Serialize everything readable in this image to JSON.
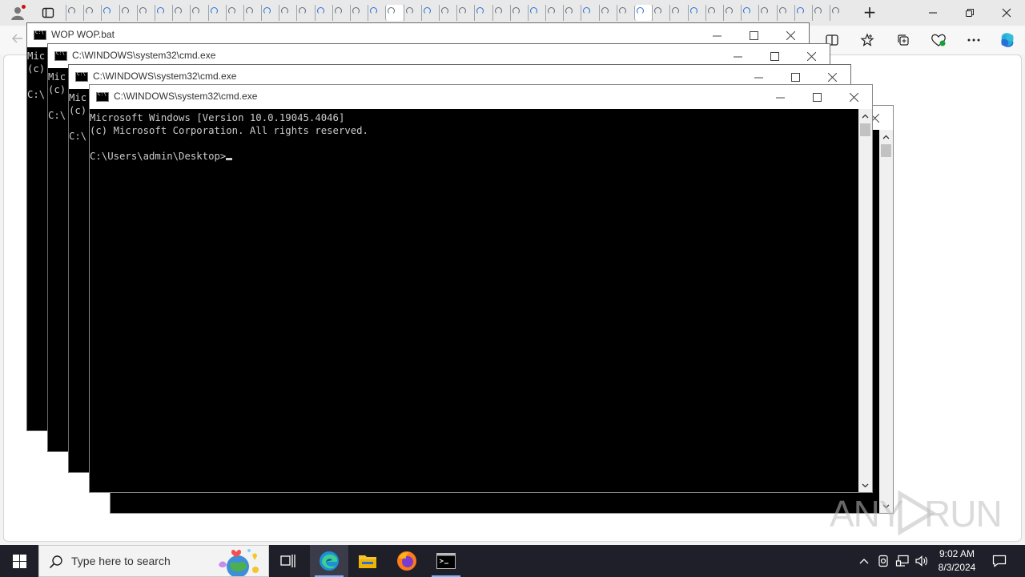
{
  "browser": {
    "window_controls": {
      "minimize": "—",
      "restore": "❐",
      "close": "✕"
    },
    "new_tab": "+",
    "tab_count": 44,
    "active_tabs": [
      18,
      32
    ]
  },
  "windows": [
    {
      "title": "WOP WOP.bat",
      "lines": [
        "Mic",
        "(c)",
        "",
        "C:\\"
      ]
    },
    {
      "title": "C:\\WINDOWS\\system32\\cmd.exe",
      "lines": [
        "Mic",
        "(c)",
        "",
        "C:\\"
      ]
    },
    {
      "title": "C:\\WINDOWS\\system32\\cmd.exe",
      "lines": [
        "Mic",
        "(c)",
        "",
        "C:\\"
      ]
    },
    {
      "title": "C:\\WINDOWS\\system32\\cmd.exe",
      "lines": [
        "Microsoft Windows [Version 10.0.19045.4046]",
        "(c) Microsoft Corporation. All rights reserved.",
        "",
        "C:\\Users\\admin\\Desktop>"
      ]
    }
  ],
  "taskbar": {
    "search_placeholder": "Type here to search",
    "time": "9:02 AM",
    "date": "8/3/2024"
  },
  "watermark": {
    "left": "ANY",
    "right": "RUN"
  },
  "colors": {
    "console_bg": "#000000",
    "console_fg": "#cccccc",
    "taskbar_bg": "#1f1f2a",
    "accent": "#2a6fd6"
  }
}
